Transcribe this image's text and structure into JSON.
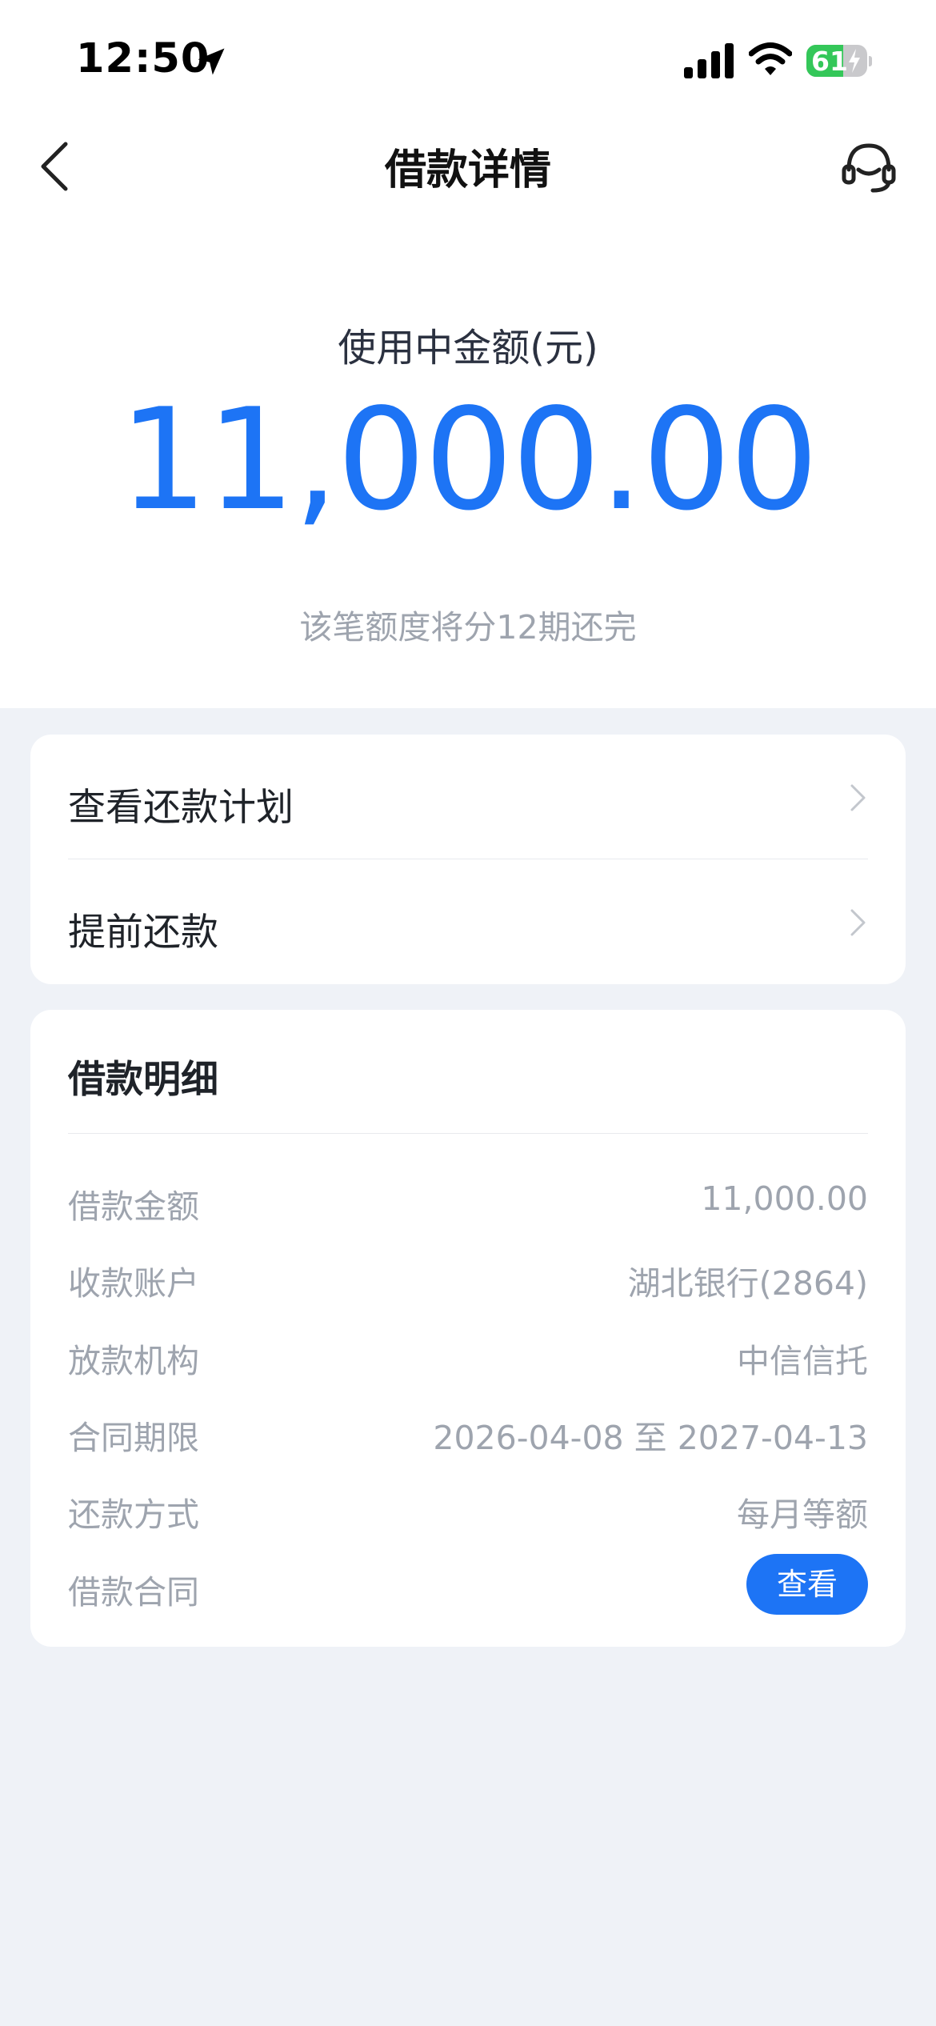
{
  "status_bar": {
    "time": "12:50",
    "battery": "61",
    "battery_level": 0.61
  },
  "nav": {
    "title": "借款详情"
  },
  "hero": {
    "label": "使用中金额(元)",
    "amount": "11,000.00",
    "note": "该笔额度将分12期还完"
  },
  "actions": [
    {
      "label": "查看还款计划"
    },
    {
      "label": "提前还款"
    }
  ],
  "detail": {
    "title": "借款明细",
    "rows": [
      {
        "key": "借款金额",
        "value": "11,000.00"
      },
      {
        "key": "收款账户",
        "value": "湖北银行(2864)"
      },
      {
        "key": "放款机构",
        "value": "中信信托"
      },
      {
        "key": "合同期限",
        "value": "2026-04-08 至 2027-04-13"
      },
      {
        "key": "还款方式",
        "value": "每月等额"
      },
      {
        "key": "借款合同",
        "button": "查看"
      }
    ]
  },
  "colors": {
    "accent": "#1d74f5",
    "page_bg": "#eff2f7",
    "muted_text": "#9ea4ae"
  }
}
